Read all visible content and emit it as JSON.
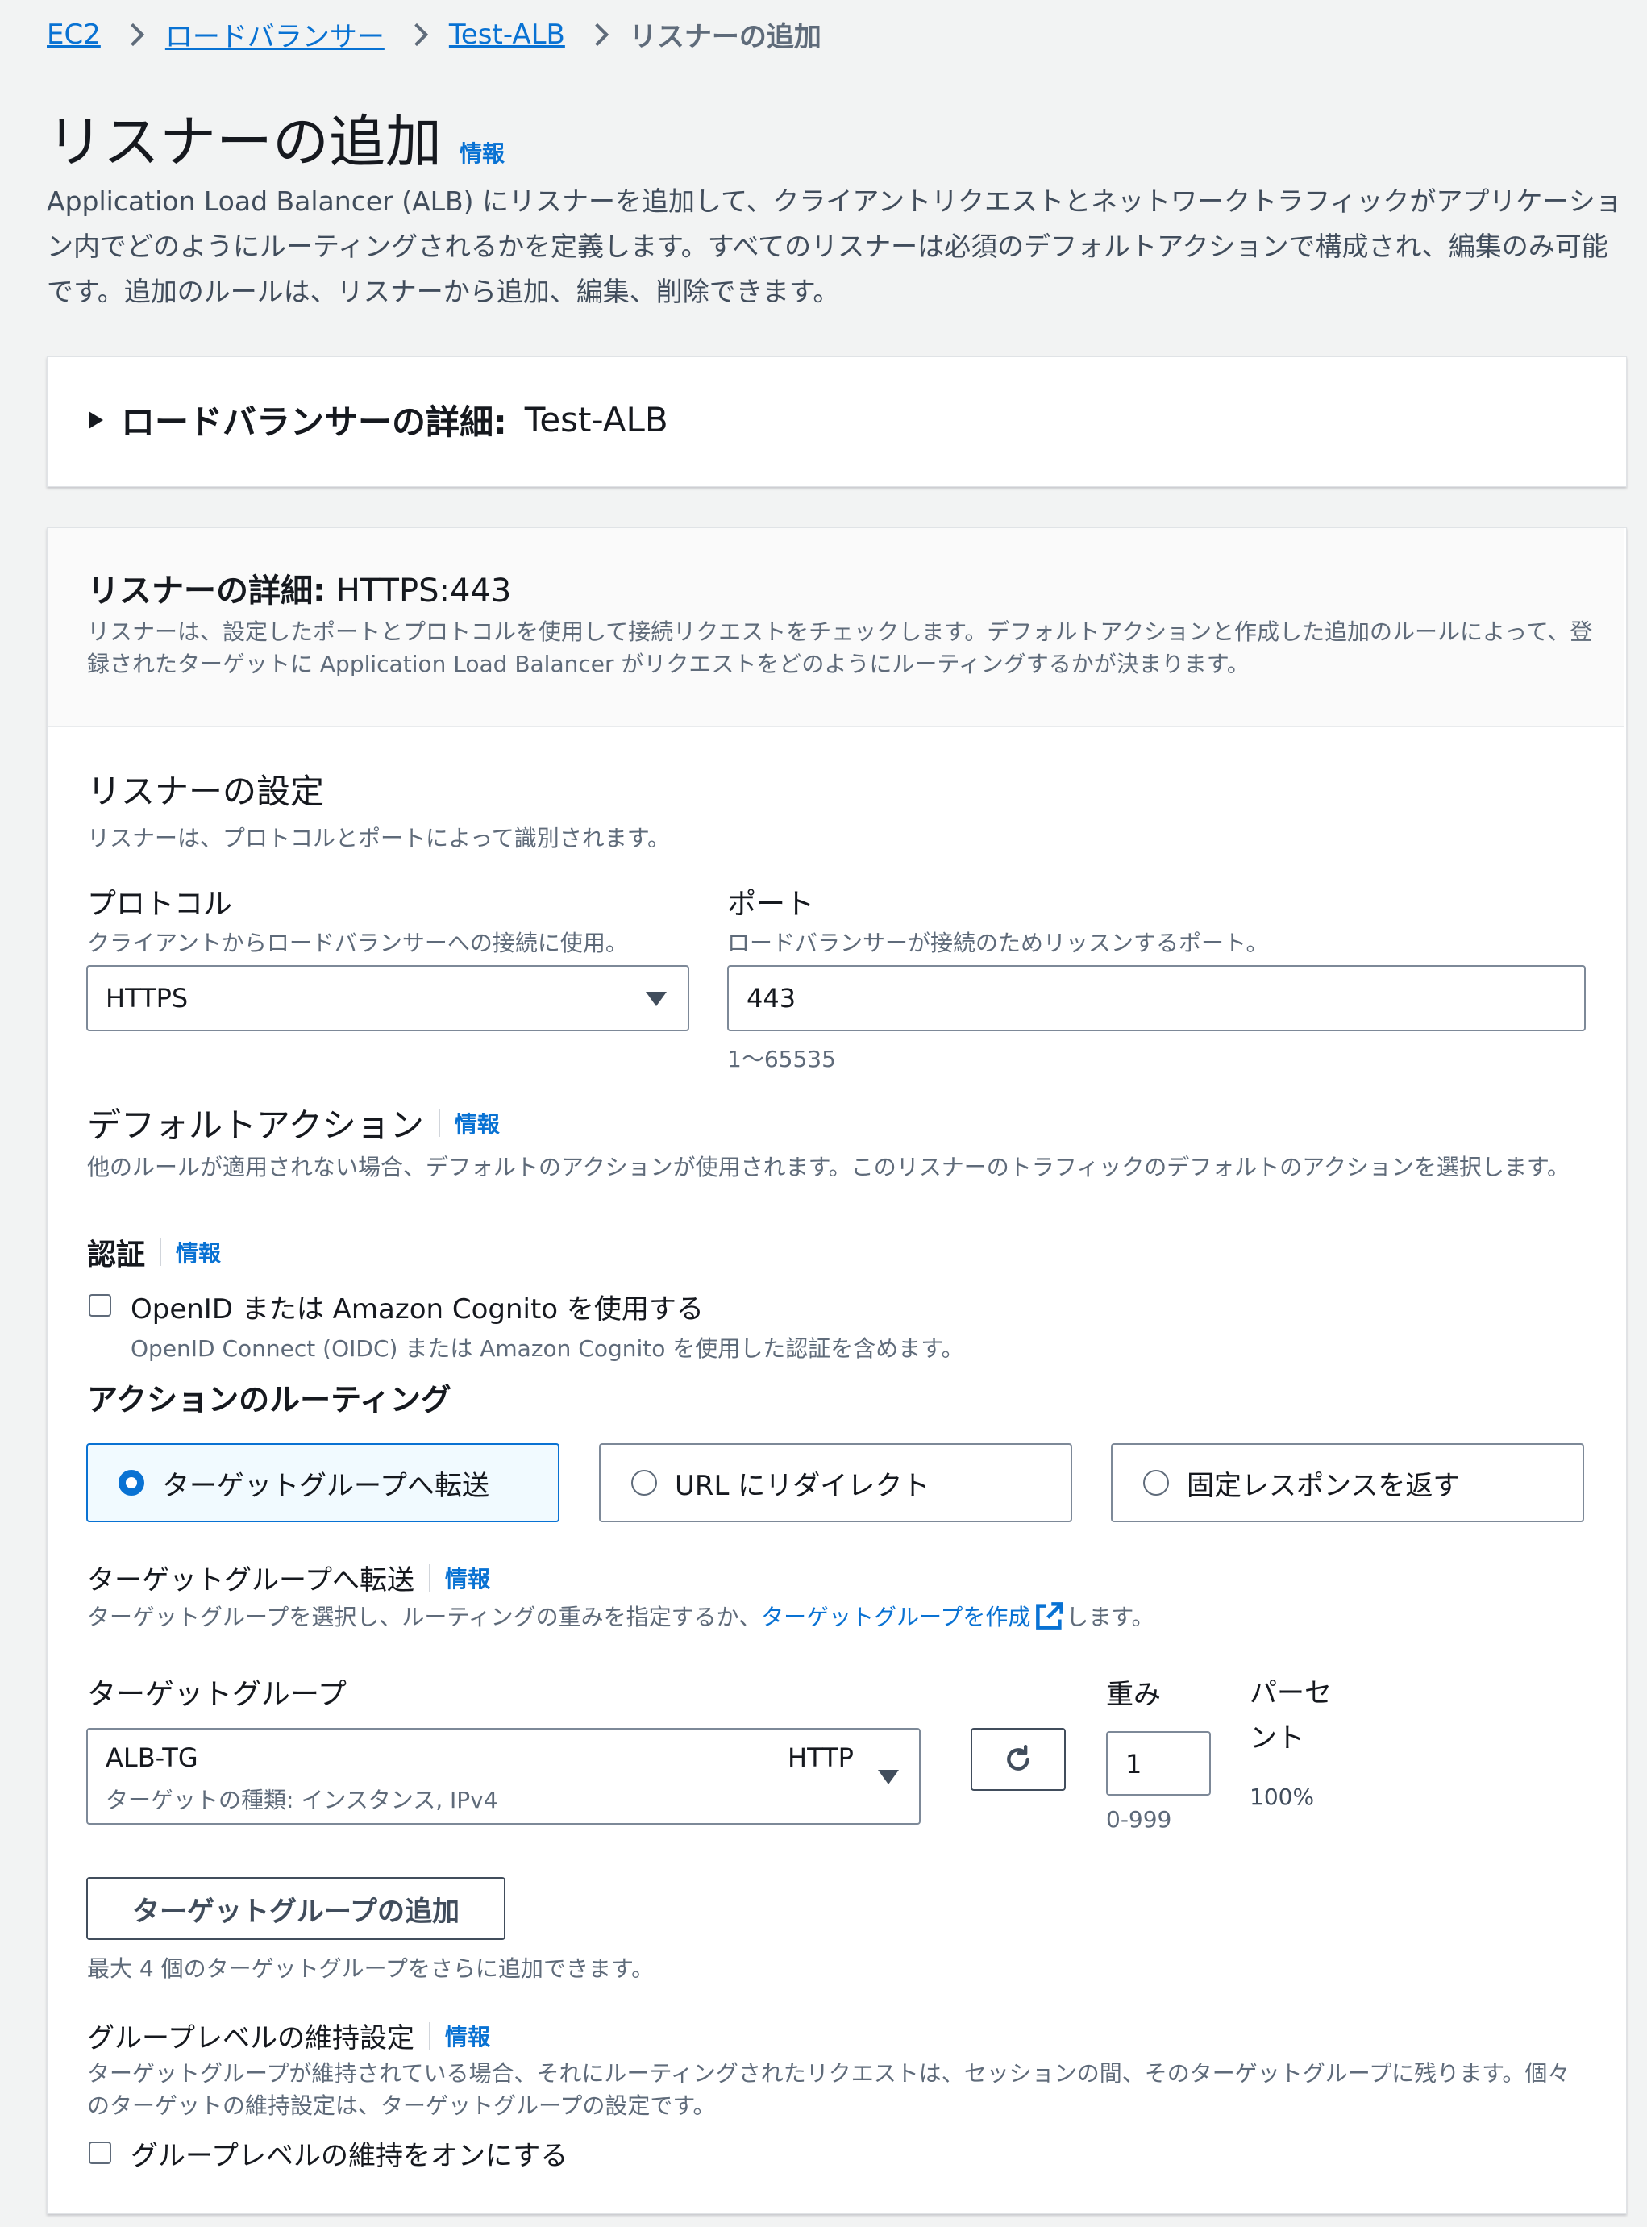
{
  "breadcrumb": {
    "items": [
      "EC2",
      "ロードバランサー",
      "Test-ALB"
    ],
    "current": "リスナーの追加"
  },
  "page": {
    "title": "リスナーの追加",
    "info": "情報",
    "description": "Application Load Balancer (ALB) にリスナーを追加して、クライアントリクエストとネットワークトラフィックがアプリケーション内でどのようにルーティングされるかを定義します。すべてのリスナーは必須のデフォルトアクションで構成され、編集のみ可能です。追加のルールは、リスナーから追加、編集、削除できます。"
  },
  "lb_details": {
    "label": "ロードバランサーの詳細:",
    "name": "Test-ALB"
  },
  "listener_details": {
    "label": "リスナーの詳細:",
    "value": "HTTPS:443",
    "description": "リスナーは、設定したポートとプロトコルを使用して接続リクエストをチェックします。デフォルトアクションと作成した追加のルールによって、登録されたターゲットに Application Load Balancer がリクエストをどのようにルーティングするかが決まります。"
  },
  "listener_config": {
    "title": "リスナーの設定",
    "description": "リスナーは、プロトコルとポートによって識別されます。",
    "protocol": {
      "label": "プロトコル",
      "description": "クライアントからロードバランサーへの接続に使用。",
      "value": "HTTPS"
    },
    "port": {
      "label": "ポート",
      "description": "ロードバランサーが接続のためリッスンするポート。",
      "value": "443",
      "hint": "1〜65535"
    }
  },
  "default_action": {
    "title": "デフォルトアクション",
    "info": "情報",
    "description": "他のルールが適用されない場合、デフォルトのアクションが使用されます。このリスナーのトラフィックのデフォルトのアクションを選択します。",
    "auth": {
      "title": "認証",
      "info": "情報",
      "checkbox_label": "OpenID または Amazon Cognito を使用する",
      "checkbox_desc": "OpenID Connect (OIDC) または Amazon Cognito を使用した認証を含めます。",
      "checked": false
    },
    "routing": {
      "title": "アクションのルーティング",
      "options": [
        "ターゲットグループへ転送",
        "URL にリダイレクト",
        "固定レスポンスを返す"
      ],
      "selected": "ターゲットグループへ転送"
    }
  },
  "forward": {
    "title": "ターゲットグループへ転送",
    "info": "情報",
    "desc_prefix": "ターゲットグループを選択し、ルーティングの重みを指定するか、",
    "desc_link": "ターゲットグループを作成",
    "desc_suffix": "します。",
    "target_group_label": "ターゲットグループ",
    "weight_label": "重み",
    "percent_label": "パーセント",
    "selected_group": {
      "name": "ALB-TG",
      "protocol": "HTTP",
      "detail": "ターゲットの種類: インスタンス, IPv4"
    },
    "weight_value": "1",
    "weight_hint": "0-999",
    "percent_value": "100%",
    "add_button": "ターゲットグループの追加",
    "add_hint": "最大 4 個のターゲットグループをさらに追加できます。"
  },
  "stickiness": {
    "title": "グループレベルの維持設定",
    "info": "情報",
    "description": "ターゲットグループが維持されている場合、それにルーティングされたリクエストは、セッションの間、そのターゲットグループに残ります。個々のターゲットの維持設定は、ターゲットグループの設定です。",
    "checkbox_label": "グループレベルの維持をオンにする",
    "checked": false
  },
  "colors": {
    "link": "#0972d3",
    "background": "#f2f3f3",
    "selected_card": "#f1faff"
  }
}
